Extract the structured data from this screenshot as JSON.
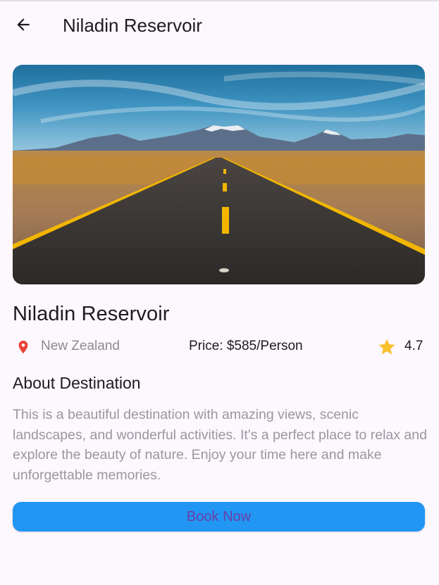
{
  "appbar": {
    "title": "Niladin Reservoir",
    "back_icon": "arrow-back-icon"
  },
  "destination": {
    "name": "Niladin Reservoir",
    "location": "New Zealand",
    "price": "Price: $585/Person",
    "rating": "4.7",
    "location_icon": "location-pin-icon",
    "rating_icon": "star-icon",
    "image_description_icon": "desert-road-photo"
  },
  "about": {
    "heading": "About Destination",
    "text": "This is a beautiful destination with amazing views, scenic landscapes, and wonderful activities. It's a perfect place to relax and explore the beauty of nature. Enjoy your time here and make unforgettable memories."
  },
  "actions": {
    "book_label": "Book Now"
  },
  "colors": {
    "background": "#fdf7fe",
    "button": "#2196f3",
    "button_text": "#6a3fa8",
    "pin": "#ea4335",
    "star": "#fbc02d"
  }
}
